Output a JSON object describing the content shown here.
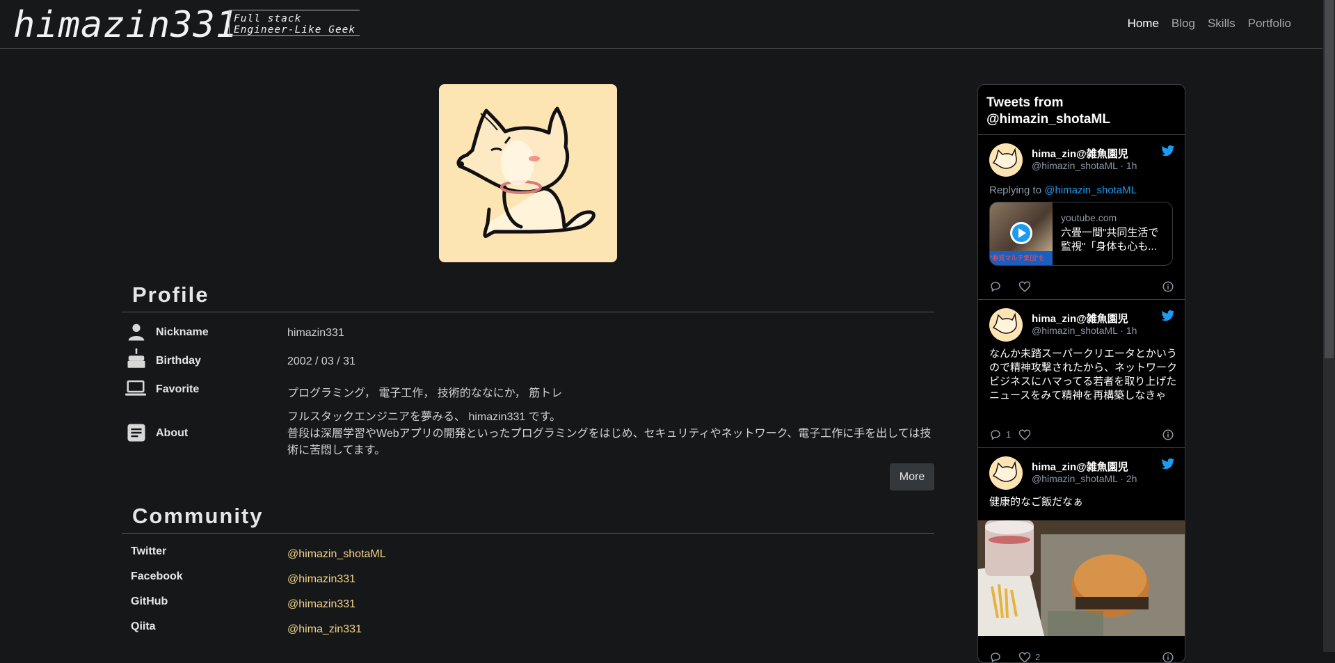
{
  "header": {
    "logo": "himazin331",
    "tagline_line1": "Full stack",
    "tagline_line2": "Engineer-Like Geek",
    "nav": [
      "Home",
      "Blog",
      "Skills",
      "Portfolio"
    ]
  },
  "profile": {
    "title": "Profile",
    "rows": [
      {
        "label": "Nickname",
        "value": "himazin331",
        "icon": "person-icon"
      },
      {
        "label": "Birthday",
        "value": "2002 / 03 / 31",
        "icon": "cake-icon"
      },
      {
        "label": "Favorite",
        "value": "プログラミング， 電子工作， 技術的ななにか， 筋トレ",
        "icon": "laptop-icon"
      },
      {
        "label": "About",
        "icon": "document-icon"
      }
    ],
    "about_line1": "フルスタックエンジニアを夢みる、 himazin331 です。",
    "about_line2": "普段は深層学習やWebアプリの開発といったプログラミングをはじめ、セキュリティやネットワーク、電子工作に手を出しては技術に苦悶してます。",
    "more_label": "More"
  },
  "community": {
    "title": "Community",
    "rows": [
      {
        "label": "Twitter",
        "value": "@himazin_shotaML"
      },
      {
        "label": "Facebook",
        "value": "@himazin331"
      },
      {
        "label": "GitHub",
        "value": "@himazin331"
      },
      {
        "label": "Qiita",
        "value": "@hima_zin331"
      }
    ]
  },
  "twitter": {
    "header": "Tweets from @himazin_shotaML",
    "tweets": [
      {
        "name": "hima_zin@雑魚園児",
        "handle": "@himazin_shotaML · 1h",
        "replying_prefix": "Replying to",
        "replying_to": "@himazin_shotaML",
        "card_domain": "youtube.com",
        "card_title": "六畳一間\"共同生活で監視\"「身体も心も...",
        "card_thumb_caption": "\"悪質マルチ集団\"を"
      },
      {
        "name": "hima_zin@雑魚園児",
        "handle": "@himazin_shotaML · 1h",
        "text": "なんか未踏スーパークリエータとかいうので精神攻撃されたから、ネットワークビジネスにハマってる若者を取り上げたニュースをみて精神を再構築しなきゃ",
        "reply_count": "1"
      },
      {
        "name": "hima_zin@雑魚園児",
        "handle": "@himazin_shotaML · 2h",
        "text": "健康的なご飯だなぁ",
        "like_count": "2"
      }
    ]
  },
  "colors": {
    "background": "#161719",
    "link": "#f2d48a",
    "twitter_blue": "#1d9bf0",
    "avatar_bg": "#fde4b3"
  }
}
